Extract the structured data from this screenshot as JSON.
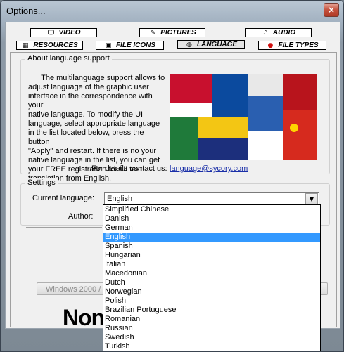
{
  "window": {
    "title": "Options...",
    "close_symbol": "×"
  },
  "tabs_row1": [
    {
      "label": "VIDEO",
      "icon": "monitor-icon"
    },
    {
      "label": "PICTURES",
      "icon": "camera-icon"
    },
    {
      "label": "AUDIO",
      "icon": "speaker-icon"
    }
  ],
  "tabs_row2": [
    {
      "label": "RESOURCES",
      "icon": "resources-icon"
    },
    {
      "label": "FILE ICONS",
      "icon": "file-icons-icon"
    },
    {
      "label": "LANGUAGE",
      "icon": "globe-icon",
      "active": true
    },
    {
      "label": "FILE TYPES",
      "icon": "help-icon"
    }
  ],
  "about": {
    "title": "About language support",
    "paragraph": "The multilanguage support allows to adjust language of the graphic user interface in the correspondence with your native language. To modify the UI language, select appropriate language in the list located below, press the button \"Apply\" and restart. If there is no your native language in the list, you can get your FREE registration for UI text translation from English.",
    "lines": [
      "      The multilanguage support allows to",
      "adjust language of the graphic user",
      "interface in the correspondence with your",
      "native language. To modify the UI",
      "language, select appropriate language",
      "in the list located below, press the button",
      "\"Apply\" and restart. If there is no your",
      "native language in the list, you can get",
      "your FREE registration for UI text",
      "translation from English."
    ],
    "contact_label": "For details contact us:",
    "contact_email": "language@sycory.com"
  },
  "settings": {
    "title": "Settings",
    "current_language_label": "Current language:",
    "current_language_value": "English",
    "author_label": "Author:"
  },
  "dropdown": {
    "options": [
      "Simplified Chinese",
      "Danish",
      "German",
      "English",
      "Spanish",
      "Hungarian",
      "Italian",
      "Macedonian",
      "Dutch",
      "Norwegian",
      "Polish",
      "Brazilian Portuguese",
      "Romanian",
      "Russian",
      "Swedish",
      "Turkish"
    ],
    "selected": "English"
  },
  "bottom": {
    "windows_button": "Windows 2000 / X",
    "logo_text": "Non"
  },
  "colors": {
    "selection": "#3399ff",
    "link": "#1a2fa8"
  }
}
